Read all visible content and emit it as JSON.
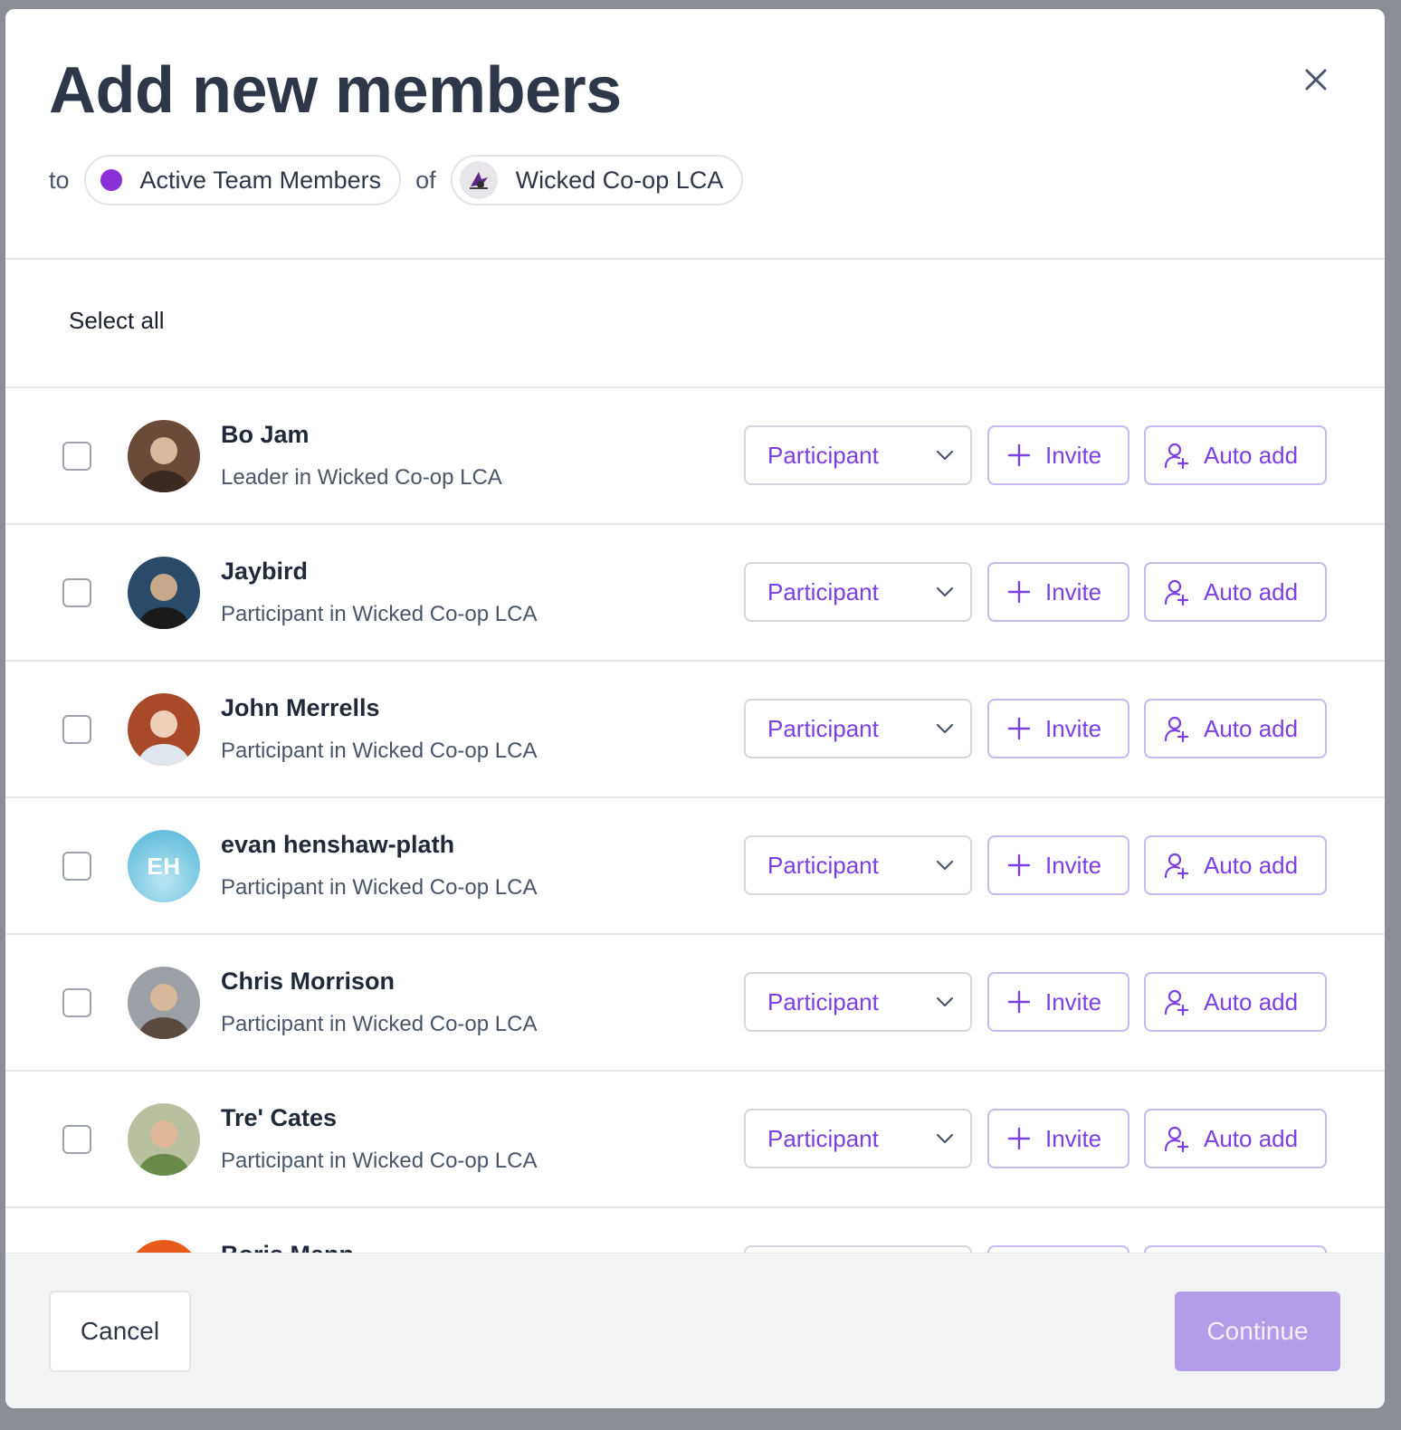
{
  "modal": {
    "title": "Add new members",
    "to_label": "to",
    "of_label": "of",
    "team_chip": {
      "label": "Active Team Members",
      "color": "#8b2fd9"
    },
    "org_chip": {
      "label": "Wicked Co-op LCA"
    }
  },
  "select_all_label": "Select all",
  "action_labels": {
    "role": "Participant",
    "invite": "Invite",
    "auto_add": "Auto add"
  },
  "members": [
    {
      "name": "Bo Jam",
      "role_text": "Leader in Wicked Co-op LCA",
      "avatar": "photo"
    },
    {
      "name": "Jaybird",
      "role_text": "Participant in Wicked Co-op LCA",
      "avatar": "photo"
    },
    {
      "name": "John Merrells",
      "role_text": "Participant in Wicked Co-op LCA",
      "avatar": "photo"
    },
    {
      "name": "evan henshaw-plath",
      "role_text": "Participant in Wicked Co-op LCA",
      "avatar": "initials",
      "initials": "EH"
    },
    {
      "name": "Chris Morrison",
      "role_text": "Participant in Wicked Co-op LCA",
      "avatar": "photo"
    },
    {
      "name": "Tre' Cates",
      "role_text": "Participant in Wicked Co-op LCA",
      "avatar": "photo"
    },
    {
      "name": "Boris Mann",
      "role_text": "",
      "avatar": "photo"
    }
  ],
  "footer": {
    "cancel_label": "Cancel",
    "continue_label": "Continue"
  },
  "colors": {
    "accent": "#7b3fe4",
    "continue_disabled": "#b39ce8"
  },
  "icons": {
    "close": "close-icon",
    "chevron": "chevron-down-icon",
    "plus": "plus-icon",
    "user_plus": "user-plus-icon"
  }
}
